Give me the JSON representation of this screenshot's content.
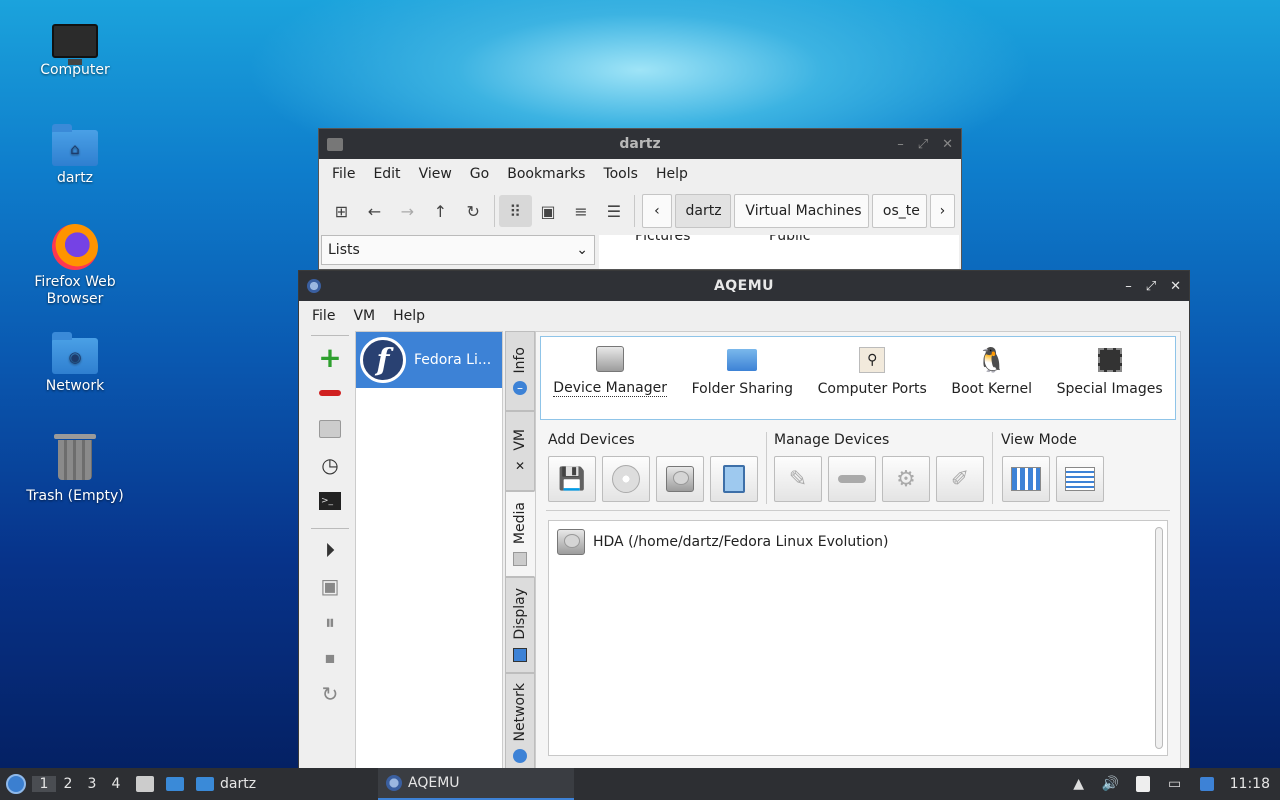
{
  "desktop": {
    "icons": [
      {
        "label": "Computer"
      },
      {
        "label": "dartz"
      },
      {
        "label": "Firefox Web Browser"
      },
      {
        "label": "Network"
      },
      {
        "label": "Trash (Empty)"
      }
    ]
  },
  "file_manager": {
    "title": "dartz",
    "menu": [
      "File",
      "Edit",
      "View",
      "Go",
      "Bookmarks",
      "Tools",
      "Help"
    ],
    "breadcrumbs": [
      "dartz",
      "Virtual Machines",
      "os_te"
    ],
    "side_combo": "Lists",
    "visible_items": [
      "Pictures",
      "Public"
    ]
  },
  "aqemu": {
    "title": "AQEMU",
    "menu": [
      "File",
      "VM",
      "Help"
    ],
    "vm_list": [
      {
        "name": "Fedora Li..."
      }
    ],
    "tabs": [
      "Info",
      "VM",
      "Media",
      "Display",
      "Network"
    ],
    "active_tab": "Media",
    "top_items": [
      "Device Manager",
      "Folder Sharing",
      "Computer Ports",
      "Boot Kernel",
      "Special Images"
    ],
    "groups": {
      "add": "Add Devices",
      "manage": "Manage Devices",
      "view": "View Mode"
    },
    "devices": [
      {
        "name": "HDA (/home/dartz/Fedora Linux Evolution)"
      }
    ]
  },
  "taskbar": {
    "workspaces": [
      "1",
      "2",
      "3",
      "4"
    ],
    "tasks": [
      {
        "label": "dartz"
      },
      {
        "label": "AQEMU"
      }
    ],
    "clock": "11:18"
  },
  "colors": {
    "accent": "#3d82d6",
    "titlebar": "#2f3136",
    "taskbar": "#2d2f33"
  }
}
